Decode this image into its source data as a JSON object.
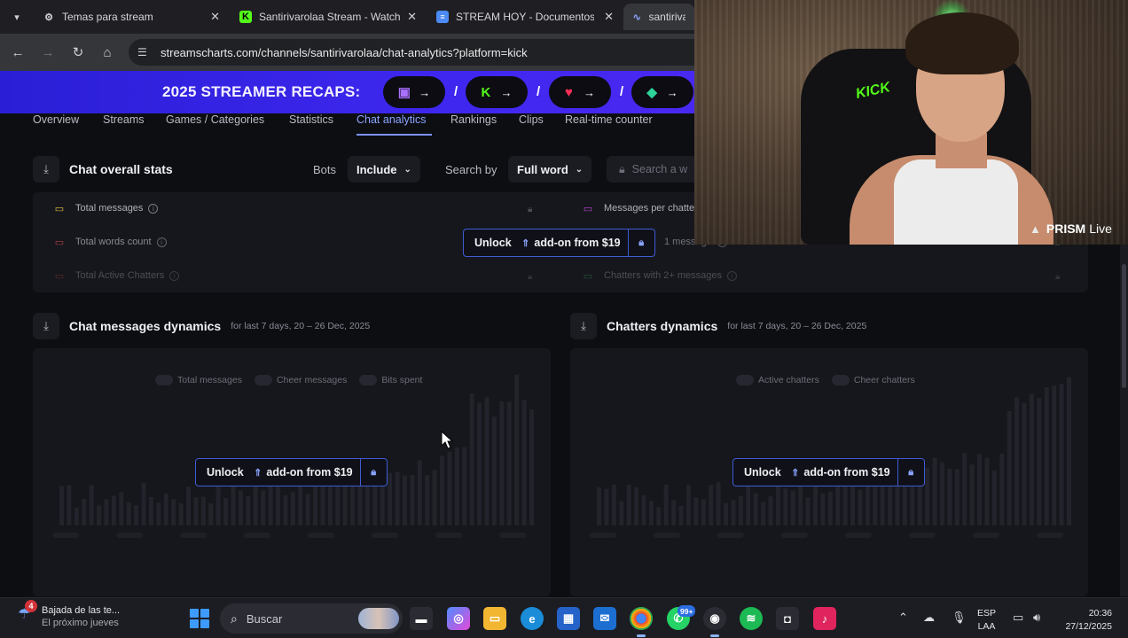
{
  "browser": {
    "tabs": [
      {
        "title": "Temas para stream",
        "favicon": "settings-favicon"
      },
      {
        "title": "Santirivarolaa Stream - Watch L",
        "favicon": "kick-favicon"
      },
      {
        "title": "STREAM HOY - Documentos de",
        "favicon": "docs-favicon"
      },
      {
        "title": "santirivaro",
        "favicon": "streamscharts-favicon"
      }
    ],
    "url": "streamscharts.com/channels/santirivarolaa/chat-analytics?platform=kick"
  },
  "banner": {
    "title": "2025 STREAMER RECAPS:",
    "slash": "/",
    "platforms": [
      "twitch-logo",
      "kick-logo",
      "heart-logo",
      "gem-logo"
    ],
    "kick_letter": "K"
  },
  "nav": {
    "tabs": [
      "Overview",
      "Streams",
      "Games / Categories",
      "Statistics",
      "Chat analytics",
      "Rankings",
      "Clips",
      "Real-time counter"
    ],
    "active": "Chat analytics"
  },
  "overall": {
    "title": "Chat overall stats",
    "bots_label": "Bots",
    "bots_value": "Include",
    "search_by_label": "Search by",
    "search_by_value": "Full word",
    "search_placeholder": "Search a w",
    "left_stats": [
      "Total messages",
      "Total words count",
      "Total Active Chatters"
    ],
    "right_stats": [
      "Messages per chatte",
      "1 message",
      "Chatters with 2+ messages"
    ]
  },
  "unlock": {
    "text": "Unlock",
    "addon": "add-on from $19"
  },
  "messages_chart": {
    "title": "Chat messages dynamics",
    "subtitle": "for last 7 days, 20 – 26 Dec, 2025",
    "legend": [
      "Total messages",
      "Cheer messages",
      "Bits spent"
    ]
  },
  "chatters_chart": {
    "title": "Chatters dynamics",
    "subtitle": "for last 7 days, 20 – 26 Dec, 2025",
    "legend": [
      "Active chatters",
      "Cheer chatters"
    ]
  },
  "webcam": {
    "chair_logo": "KICK",
    "prism_brand": "PRISM",
    "prism_suffix": "Live"
  },
  "taskbar": {
    "weather_badge": "4",
    "weather_line1": "Bajada de las te...",
    "weather_line2": "El próximo jueves",
    "search_placeholder": "Buscar",
    "whatsapp_badge": "99+",
    "lang_line1": "ESP",
    "lang_line2": "LAA",
    "time": "20:36",
    "date": "27/12/2025"
  },
  "colors": {
    "accent": "#8aa4ff",
    "banner": "#3f27f0",
    "kick_green": "#53fc18",
    "background": "#0d0e12"
  }
}
